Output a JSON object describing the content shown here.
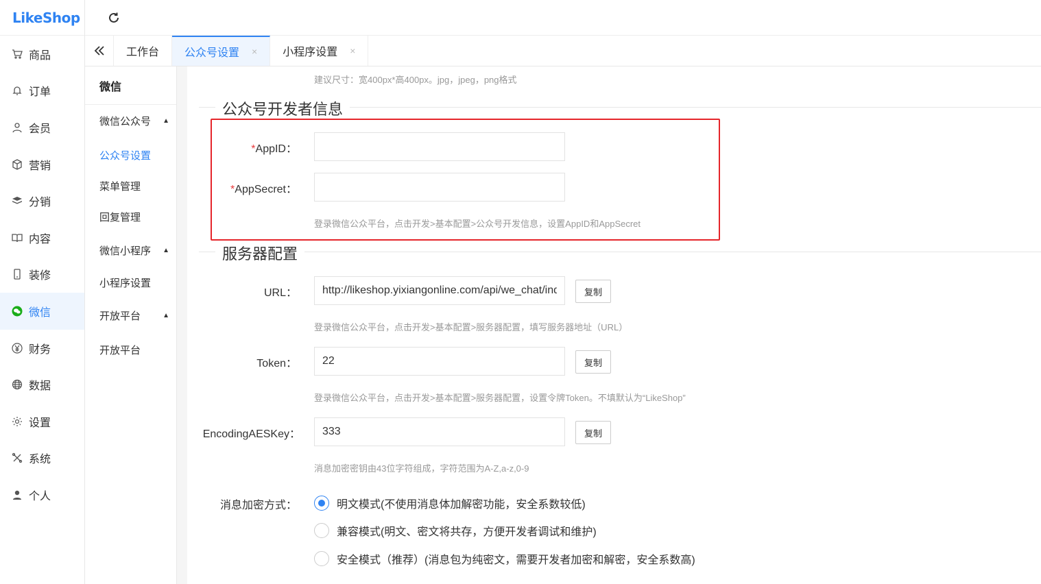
{
  "logo": {
    "part1": "Like",
    "part2": "Shop"
  },
  "sidebar": {
    "items": [
      {
        "label": "商品",
        "icon": "cart-icon"
      },
      {
        "label": "订单",
        "icon": "bell-icon"
      },
      {
        "label": "会员",
        "icon": "user-icon"
      },
      {
        "label": "营销",
        "icon": "box-icon"
      },
      {
        "label": "分销",
        "icon": "layers-icon"
      },
      {
        "label": "内容",
        "icon": "book-icon"
      },
      {
        "label": "装修",
        "icon": "phone-icon"
      },
      {
        "label": "微信",
        "icon": "wechat-icon"
      },
      {
        "label": "财务",
        "icon": "yen-icon"
      },
      {
        "label": "数据",
        "icon": "globe-icon"
      },
      {
        "label": "设置",
        "icon": "gear-icon"
      },
      {
        "label": "系统",
        "icon": "tools-icon"
      },
      {
        "label": "个人",
        "icon": "person-icon"
      }
    ],
    "active_index": 7
  },
  "tabs": [
    {
      "label": "工作台",
      "closable": false
    },
    {
      "label": "公众号设置",
      "closable": true
    },
    {
      "label": "小程序设置",
      "closable": true
    }
  ],
  "tab_close_symbol": "×",
  "subside": {
    "head": "微信",
    "group1": "微信公众号",
    "group1_items": [
      "公众号设置",
      "菜单管理",
      "回复管理"
    ],
    "group2": "微信小程序",
    "group2_items": [
      "小程序设置"
    ],
    "group3": "开放平台",
    "group3_items": [
      "开放平台"
    ]
  },
  "form": {
    "top_tip": "建议尺寸：宽400px*高400px。jpg，jpeg，png格式",
    "section1": "公众号开发者信息",
    "appid_label": "AppID：",
    "appsecret_label": "AppSecret：",
    "required_mark": "*",
    "appid_value": "",
    "appsecret_value": "",
    "dev_tip": "登录微信公众平台，点击开发>基本配置>公众号开发信息，设置AppID和AppSecret",
    "section2": "服务器配置",
    "url_label": "URL：",
    "url_value": "http://likeshop.yixiangonline.com/api/we_chat/index",
    "url_tip": "登录微信公众平台，点击开发>基本配置>服务器配置，填写服务器地址（URL）",
    "token_label": "Token：",
    "token_value": "22",
    "token_tip": "登录微信公众平台，点击开发>基本配置>服务器配置，设置令牌Token。不填默认为“LikeShop”",
    "aes_label": "EncodingAESKey：",
    "aes_value": "333",
    "aes_tip": "消息加密密钥由43位字符组成，字符范围为A-Z,a-z,0-9",
    "copy_label": "复制",
    "encrypt_label": "消息加密方式：",
    "encrypt_options": [
      "明文模式(不使用消息体加解密功能，安全系数较低)",
      "兼容模式(明文、密文将共存，方便开发者调试和维护)",
      "安全模式（推荐）(消息包为纯密文，需要开发者加密和解密，安全系数高)"
    ],
    "encrypt_selected": 0
  },
  "colors": {
    "accent": "#2f83f2",
    "highlight_box": "#e5252a",
    "wechat": "#1aad19"
  }
}
